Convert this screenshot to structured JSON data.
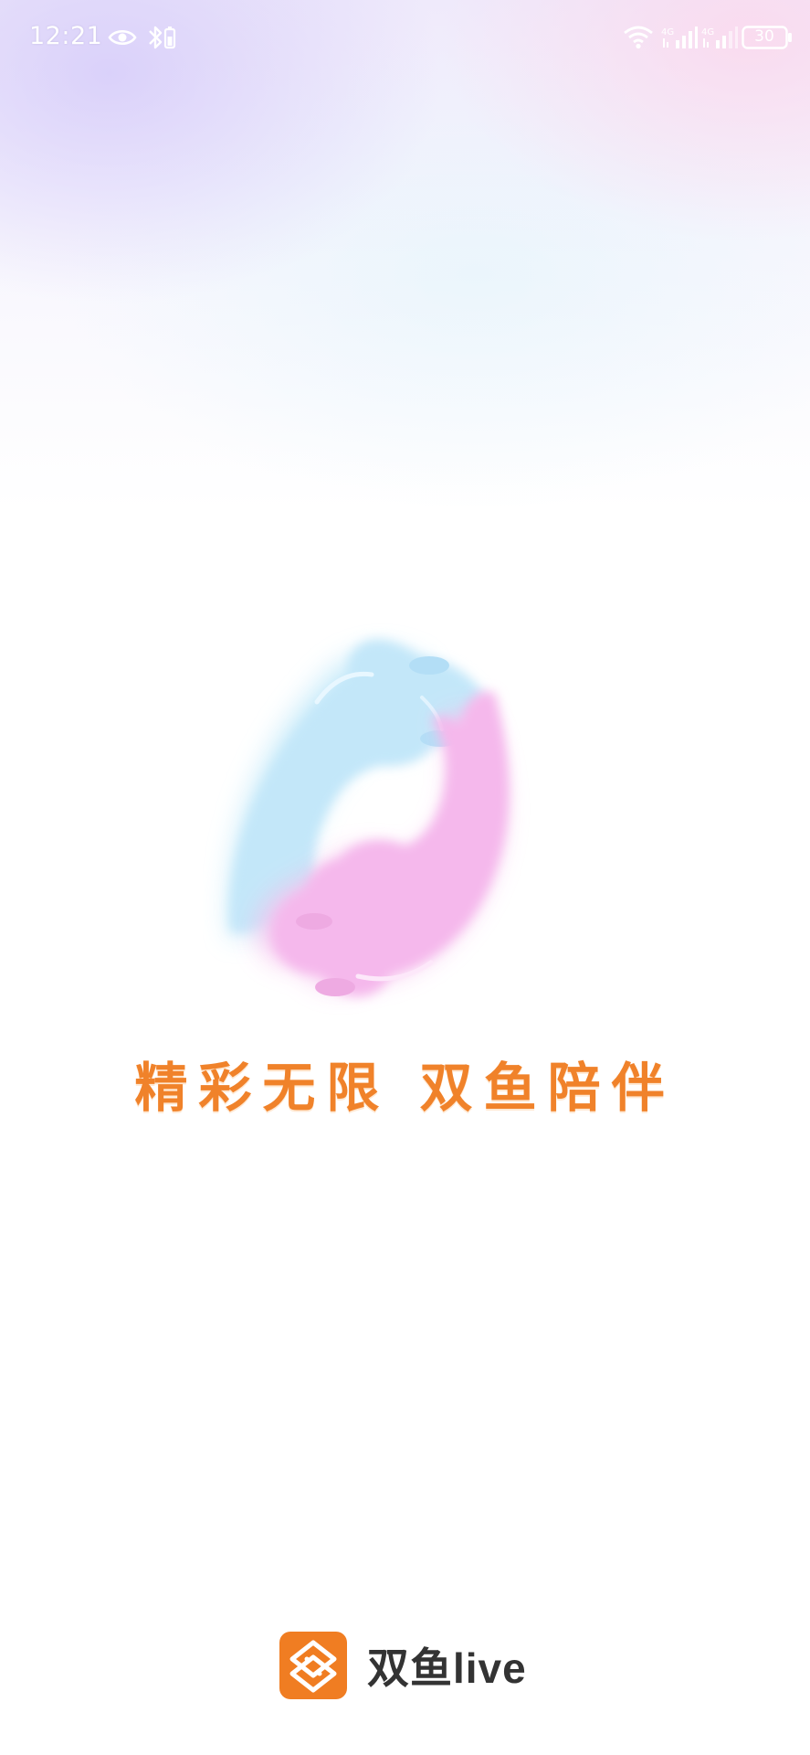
{
  "status_bar": {
    "time": "12:21",
    "battery": "30",
    "icons": [
      "eye-icon",
      "bluetooth-icon",
      "wifi-icon",
      "signal-icon",
      "signal-icon",
      "battery-icon"
    ]
  },
  "splash": {
    "slogan": "精彩无限 双鱼陪伴",
    "logo_icon": "twin-fish-logo",
    "colors": {
      "slogan": "#f0822a",
      "blue_fish": "#bfe6f8",
      "pink_fish": "#f5b6ea",
      "brand_orange": "#f07d22"
    }
  },
  "brand": {
    "app_name": "双鱼live",
    "icon": "app-logo-icon"
  }
}
